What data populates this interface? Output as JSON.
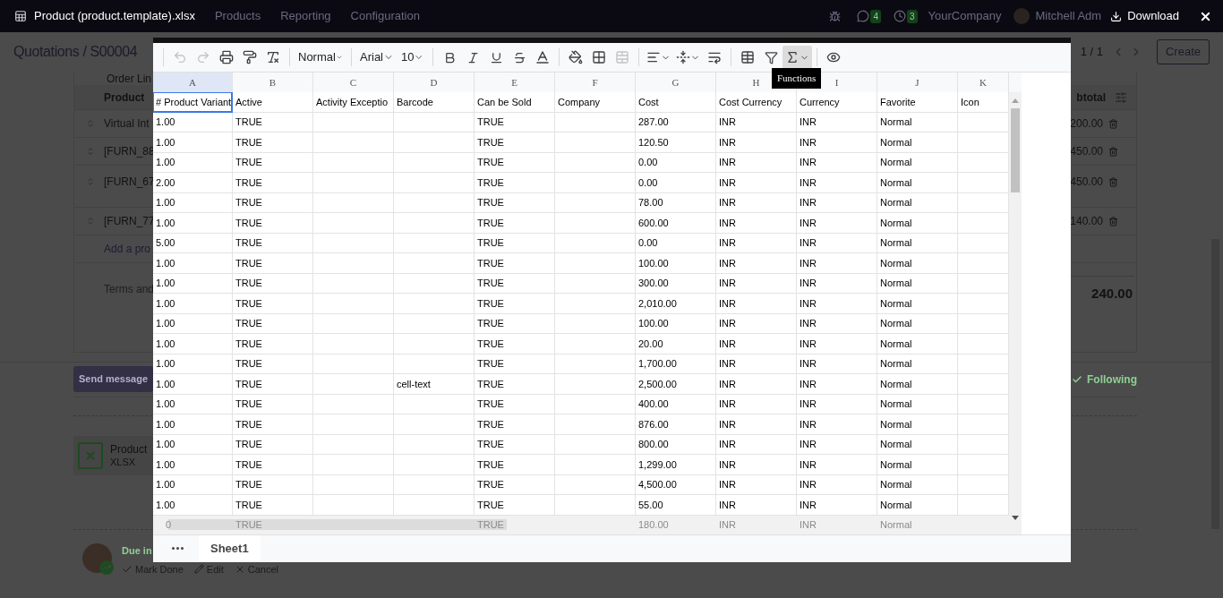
{
  "top_bar": {
    "file_title": "Product (product.template).xlsx",
    "menu": [
      "Products",
      "Reporting",
      "Configuration"
    ],
    "chat_count": "4",
    "activity_count": "3",
    "company": "YourCompany",
    "user": "Mitchell Adm",
    "download": "Download"
  },
  "control_panel": {
    "breadcrumb": "Quotations / S00004",
    "pager": "1 / 1",
    "create": "Create"
  },
  "order": {
    "tab": "Order Lin",
    "product_heading": "Product",
    "subtotal_heading": "btotal",
    "lines": [
      {
        "product": "Virtual Int",
        "subtotal": "200.00",
        "tall": false
      },
      {
        "product": "[FURN_88",
        "subtotal": "450.00",
        "tall": false
      },
      {
        "product": "[FURN_67",
        "subtotal": "450.00",
        "tall": true
      },
      {
        "product": "[FURN_77",
        "subtotal": "140.00",
        "tall": false
      }
    ],
    "add_line": "Add a pro",
    "terms": "Terms and",
    "total": "240.00"
  },
  "chatter": {
    "send_message": "Send message",
    "following": "Following",
    "attachment": {
      "name": "Product",
      "type": "XLSX"
    },
    "activity": {
      "due": "Due in",
      "actions": [
        {
          "kind": "done",
          "label": "Mark Done"
        },
        {
          "kind": "edit",
          "label": "Edit"
        },
        {
          "kind": "cancel",
          "label": "Cancel"
        }
      ]
    }
  },
  "spreadsheet": {
    "toolbar": {
      "undo_disabled": true,
      "redo_disabled": true,
      "style": "Normal",
      "font": "Arial",
      "size": "10",
      "functions_active": true,
      "tooltip": "Functions"
    },
    "columns": [
      {
        "letter": "A",
        "heading": "# Product Variant",
        "selected": true
      },
      {
        "letter": "B",
        "heading": "Active",
        "selected": false
      },
      {
        "letter": "C",
        "heading": "Activity Exceptio",
        "selected": false
      },
      {
        "letter": "D",
        "heading": "Barcode",
        "selected": false
      },
      {
        "letter": "E",
        "heading": "Can be Sold",
        "selected": false
      },
      {
        "letter": "F",
        "heading": "Company",
        "selected": false
      },
      {
        "letter": "G",
        "heading": "Cost",
        "selected": false
      },
      {
        "letter": "H",
        "heading": "Cost Currency",
        "selected": false
      },
      {
        "letter": "I",
        "heading": "Currency",
        "selected": false
      },
      {
        "letter": "J",
        "heading": "Favorite",
        "selected": false
      },
      {
        "letter": "K",
        "heading": "Icon",
        "selected": false
      }
    ],
    "rows": [
      {
        "a": "1.00",
        "b": "TRUE",
        "e": "TRUE",
        "g": "287.00",
        "h": "INR",
        "i": "INR",
        "j": "Normal"
      },
      {
        "a": "1.00",
        "b": "TRUE",
        "e": "TRUE",
        "g": "120.50",
        "h": "INR",
        "i": "INR",
        "j": "Normal"
      },
      {
        "a": "1.00",
        "b": "TRUE",
        "e": "TRUE",
        "g": "0.00",
        "h": "INR",
        "i": "INR",
        "j": "Normal"
      },
      {
        "a": "2.00",
        "b": "TRUE",
        "e": "TRUE",
        "g": "0.00",
        "h": "INR",
        "i": "INR",
        "j": "Normal"
      },
      {
        "a": "1.00",
        "b": "TRUE",
        "e": "TRUE",
        "g": "78.00",
        "h": "INR",
        "i": "INR",
        "j": "Normal"
      },
      {
        "a": "1.00",
        "b": "TRUE",
        "e": "TRUE",
        "g": "600.00",
        "h": "INR",
        "i": "INR",
        "j": "Normal"
      },
      {
        "a": "5.00",
        "b": "TRUE",
        "e": "TRUE",
        "g": "0.00",
        "h": "INR",
        "i": "INR",
        "j": "Normal"
      },
      {
        "a": "1.00",
        "b": "TRUE",
        "e": "TRUE",
        "g": "100.00",
        "h": "INR",
        "i": "INR",
        "j": "Normal"
      },
      {
        "a": "1.00",
        "b": "TRUE",
        "e": "TRUE",
        "g": "300.00",
        "h": "INR",
        "i": "INR",
        "j": "Normal"
      },
      {
        "a": "1.00",
        "b": "TRUE",
        "e": "TRUE",
        "g": "2,010.00",
        "h": "INR",
        "i": "INR",
        "j": "Normal"
      },
      {
        "a": "1.00",
        "b": "TRUE",
        "e": "TRUE",
        "g": "100.00",
        "h": "INR",
        "i": "INR",
        "j": "Normal"
      },
      {
        "a": "1.00",
        "b": "TRUE",
        "e": "TRUE",
        "g": "20.00",
        "h": "INR",
        "i": "INR",
        "j": "Normal"
      },
      {
        "a": "1.00",
        "b": "TRUE",
        "e": "TRUE",
        "g": "1,700.00",
        "h": "INR",
        "i": "INR",
        "j": "Normal"
      },
      {
        "a": "1.00",
        "b": "TRUE",
        "d": "cell-text",
        "e": "TRUE",
        "g": "2,500.00",
        "h": "INR",
        "i": "INR",
        "j": "Normal"
      },
      {
        "a": "1.00",
        "b": "TRUE",
        "e": "TRUE",
        "g": "400.00",
        "h": "INR",
        "i": "INR",
        "j": "Normal"
      },
      {
        "a": "1.00",
        "b": "TRUE",
        "e": "TRUE",
        "g": "876.00",
        "h": "INR",
        "i": "INR",
        "j": "Normal"
      },
      {
        "a": "1.00",
        "b": "TRUE",
        "e": "TRUE",
        "g": "800.00",
        "h": "INR",
        "i": "INR",
        "j": "Normal"
      },
      {
        "a": "1.00",
        "b": "TRUE",
        "e": "TRUE",
        "g": "1,299.00",
        "h": "INR",
        "i": "INR",
        "j": "Normal"
      },
      {
        "a": "1.00",
        "b": "TRUE",
        "e": "TRUE",
        "g": "4,500.00",
        "h": "INR",
        "i": "INR",
        "j": "Normal"
      },
      {
        "a": "1.00",
        "b": "TRUE",
        "e": "TRUE",
        "g": "55.00",
        "h": "INR",
        "i": "INR",
        "j": "Normal"
      }
    ],
    "partial_row": {
      "a": "0",
      "b": "TRUE",
      "e": "TRUE",
      "g": "180.00",
      "h": "INR",
      "i": "INR",
      "j": "Normal"
    },
    "sheets": [
      {
        "name": "Sheet1",
        "selected": true
      }
    ]
  }
}
